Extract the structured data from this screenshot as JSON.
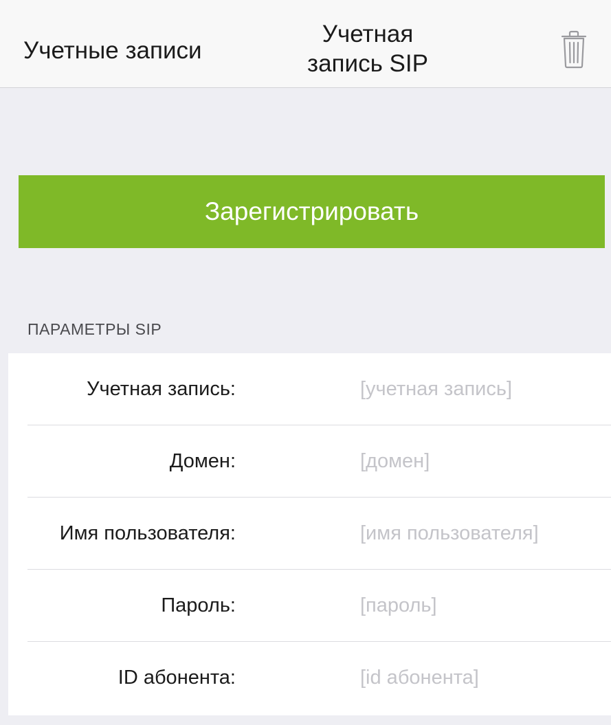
{
  "navbar": {
    "back_label": "Учетные записи",
    "title": "Учетная запись SIP",
    "trash_icon": "trash-icon"
  },
  "register_button": {
    "label": "Зарегистрировать",
    "color": "#7fb928"
  },
  "sip_section": {
    "header": "ПАРАМЕТРЫ SIP",
    "fields": [
      {
        "label": "Учетная запись:",
        "value": "",
        "placeholder": "[учетная запись]"
      },
      {
        "label": "Домен:",
        "value": "",
        "placeholder": "[домен]"
      },
      {
        "label": "Имя пользователя:",
        "value": "",
        "placeholder": "[имя пользователя]"
      },
      {
        "label": "Пароль:",
        "value": "",
        "placeholder": "[пароль]"
      },
      {
        "label": "ID абонента:",
        "value": "",
        "placeholder": "[id абонента]"
      }
    ]
  }
}
